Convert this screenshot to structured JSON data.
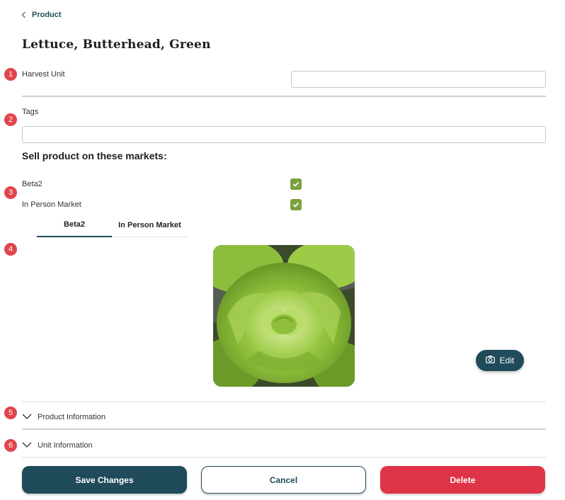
{
  "breadcrumb": {
    "label": "Product"
  },
  "page_title": "Lettuce, Butterhead, Green",
  "markers": [
    "1",
    "2",
    "3",
    "4",
    "5",
    "6"
  ],
  "fields": {
    "harvest_unit": {
      "label": "Harvest Unit",
      "value": ""
    },
    "tags": {
      "label": "Tags",
      "value": ""
    }
  },
  "markets": {
    "heading": "Sell product on these markets:",
    "items": [
      {
        "label": "Beta2",
        "checked": true
      },
      {
        "label": "In Person Market",
        "checked": true
      }
    ]
  },
  "tabs": [
    {
      "label": "Beta2",
      "active": true
    },
    {
      "label": "In Person Market",
      "active": false
    }
  ],
  "image": {
    "edit_label": "Edit",
    "icon": "camera-icon"
  },
  "accordions": [
    {
      "label": "Product Information",
      "icon": "chevron-down-icon"
    },
    {
      "label": "Unit Information",
      "icon": "chevron-down-icon"
    }
  ],
  "actions": {
    "save_label": "Save Changes",
    "cancel_label": "Cancel",
    "delete_label": "Delete"
  },
  "colors": {
    "primary": "#1f4b5a",
    "danger": "#df3447",
    "marker": "#e0454b",
    "checkbox": "#7aa13c"
  }
}
